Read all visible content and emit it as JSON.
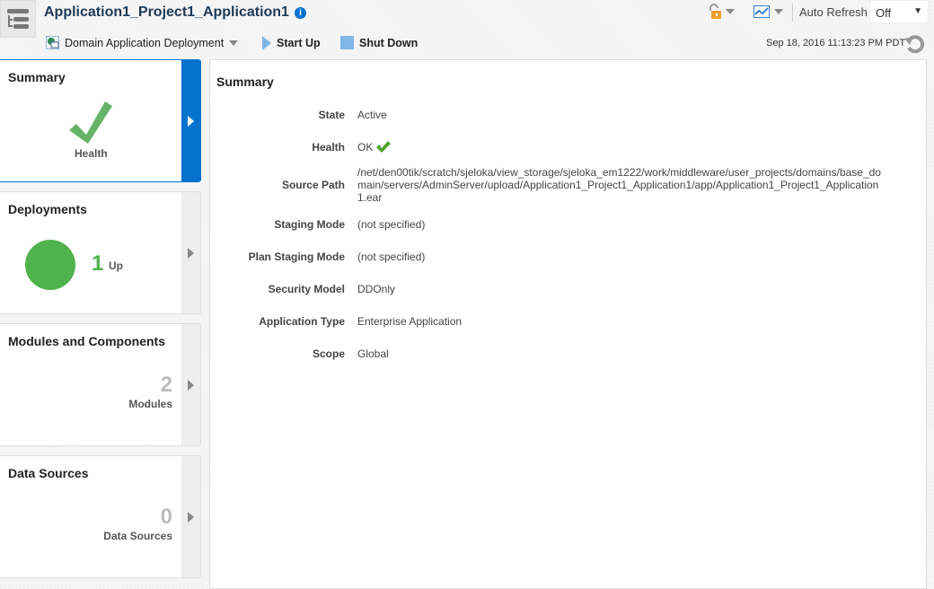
{
  "header": {
    "title": "Application1_Project1_Application1",
    "target_menu": "Domain Application Deployment",
    "start_up": "Start Up",
    "shut_down": "Shut Down",
    "auto_refresh_label": "Auto Refresh",
    "auto_refresh_value": "Off",
    "timestamp": "Sep 18, 2016 11:13:23 PM PDT"
  },
  "cards": {
    "summary": {
      "title": "Summary",
      "health_label": "Health"
    },
    "deployments": {
      "title": "Deployments",
      "count": "1",
      "status": "Up"
    },
    "modules": {
      "title": "Modules and Components",
      "count": "2",
      "label": "Modules"
    },
    "datasources": {
      "title": "Data Sources",
      "count": "0",
      "label": "Data Sources"
    }
  },
  "summary": {
    "title": "Summary",
    "rows": [
      {
        "label": "State",
        "value": "Active"
      },
      {
        "label": "Health",
        "value": "OK"
      },
      {
        "label": "Source Path",
        "value": "/net/den00tik/scratch/sjeloka/view_storage/sjeloka_em1222/work/middleware/user_projects/domains/base_domain/servers/AdminServer/upload/Application1_Project1_Application1/app/Application1_Project1_Application1.ear"
      },
      {
        "label": "Staging Mode",
        "value": "(not specified)"
      },
      {
        "label": "Plan Staging Mode",
        "value": "(not specified)"
      },
      {
        "label": "Security Model",
        "value": "DDOnly"
      },
      {
        "label": "Application Type",
        "value": "Enterprise Application"
      },
      {
        "label": "Scope",
        "value": "Global"
      }
    ]
  },
  "colors": {
    "accent": "#0572ce",
    "ok": "#4fb24c"
  }
}
